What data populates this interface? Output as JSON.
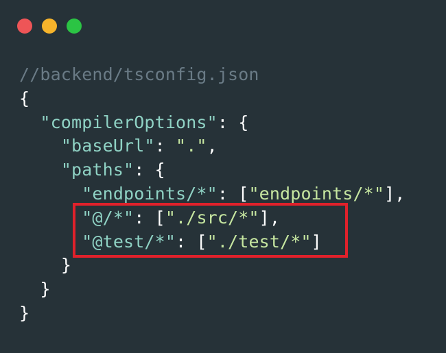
{
  "window_controls": {
    "close_color": "#ee5557",
    "minimize_color": "#f6b42b",
    "maximize_color": "#2bc444"
  },
  "colors": {
    "background": "#263238",
    "comment": "#6a7b86",
    "key": "#8fd2c4",
    "string": "#c6e6a0",
    "punctuation": "#ffffff",
    "highlight": "#e0212b"
  },
  "code": {
    "comment": "//backend/tsconfig.json",
    "open_root": "{",
    "compiler_options_key": "\"compilerOptions\"",
    "colon_open": ": {",
    "base_url_key": "\"baseUrl\"",
    "colon_space": ": ",
    "base_url_value": "\".\"",
    "comma": ",",
    "paths_key": "\"paths\"",
    "endpoints_key": "\"endpoints/*\"",
    "colon_bracket": ": [",
    "endpoints_value": "\"endpoints/*\"",
    "close_bracket_comma": "],",
    "at_key": "\"@/*\"",
    "at_value": "\"./src/*\"",
    "at_test_key": "\"@test/*\"",
    "at_test_value": "\"./test/*\"",
    "close_bracket": "]",
    "close_brace": "}"
  }
}
